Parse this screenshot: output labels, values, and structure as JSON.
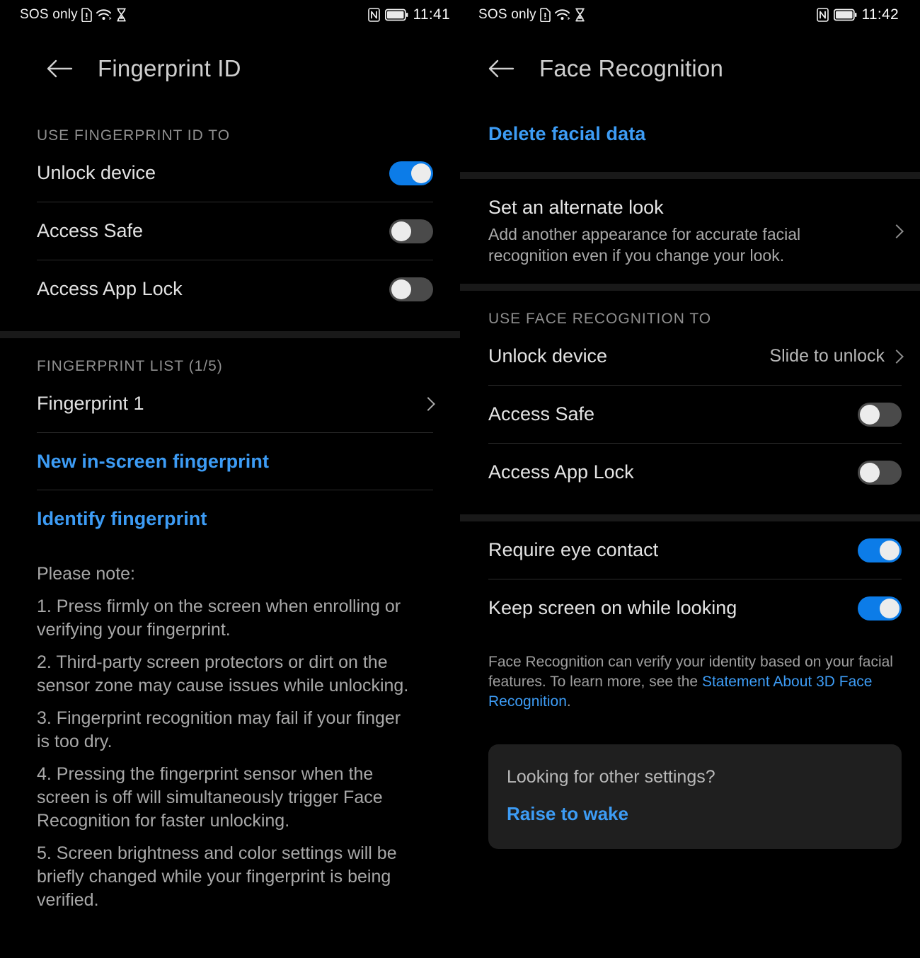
{
  "left": {
    "status": {
      "carrier": "SOS only",
      "time": "11:41",
      "icons": [
        "sim-alert-icon",
        "wifi-icon",
        "hourglass-icon",
        "nfc-icon",
        "battery-icon"
      ]
    },
    "title": "Fingerprint ID",
    "back": "back-arrow",
    "section1_header": "USE FINGERPRINT ID TO",
    "section1_rows": [
      {
        "label": "Unlock device",
        "state": "on"
      },
      {
        "label": "Access Safe",
        "state": "off"
      },
      {
        "label": "Access App Lock",
        "state": "off"
      }
    ],
    "section2_header": "FINGERPRINT LIST (1/5)",
    "fingerprints": [
      {
        "label": "Fingerprint 1"
      }
    ],
    "actions": [
      {
        "label": "New in-screen fingerprint"
      },
      {
        "label": "Identify fingerprint"
      }
    ],
    "notes_title": "Please note:",
    "notes": [
      "1. Press firmly on the screen when enrolling or verifying your fingerprint.",
      "2. Third-party screen protectors or dirt on the sensor zone may cause issues while unlocking.",
      "3. Fingerprint recognition may fail if your finger is too dry.",
      "4. Pressing the fingerprint sensor when the screen is off will simultaneously trigger Face Recognition for faster unlocking.",
      "5. Screen brightness and color settings will be briefly changed while your fingerprint is being verified."
    ]
  },
  "right": {
    "status": {
      "carrier": "SOS only",
      "time": "11:42",
      "icons": [
        "sim-alert-icon",
        "wifi-icon",
        "hourglass-icon",
        "nfc-icon",
        "battery-icon"
      ]
    },
    "title": "Face Recognition",
    "back": "back-arrow",
    "delete_label": "Delete facial data",
    "alternate_look": {
      "title": "Set an alternate look",
      "subtitle": "Add another appearance for accurate facial recognition even if you change your look."
    },
    "section_header": "USE FACE RECOGNITION TO",
    "rows": [
      {
        "label": "Unlock device",
        "value": "Slide to unlock",
        "type": "value"
      },
      {
        "label": "Access Safe",
        "state": "off",
        "type": "toggle"
      },
      {
        "label": "Access App Lock",
        "state": "off",
        "type": "toggle"
      }
    ],
    "rows2": [
      {
        "label": "Require eye contact",
        "state": "on",
        "type": "toggle"
      },
      {
        "label": "Keep screen on while looking",
        "state": "on",
        "type": "toggle"
      }
    ],
    "footnote_pre": "Face Recognition can verify your identity based on your facial features. To learn more, see the ",
    "footnote_link": "Statement About 3D Face Recognition",
    "footnote_post": ".",
    "card": {
      "question": "Looking for other settings?",
      "link": "Raise to wake"
    }
  },
  "colors": {
    "accent_blue": "#3d9cf5",
    "toggle_on": "#0c7ce8",
    "toggle_off": "#4a4a4a",
    "background": "#000000",
    "band": "#191919",
    "card": "#1f1f1f"
  }
}
